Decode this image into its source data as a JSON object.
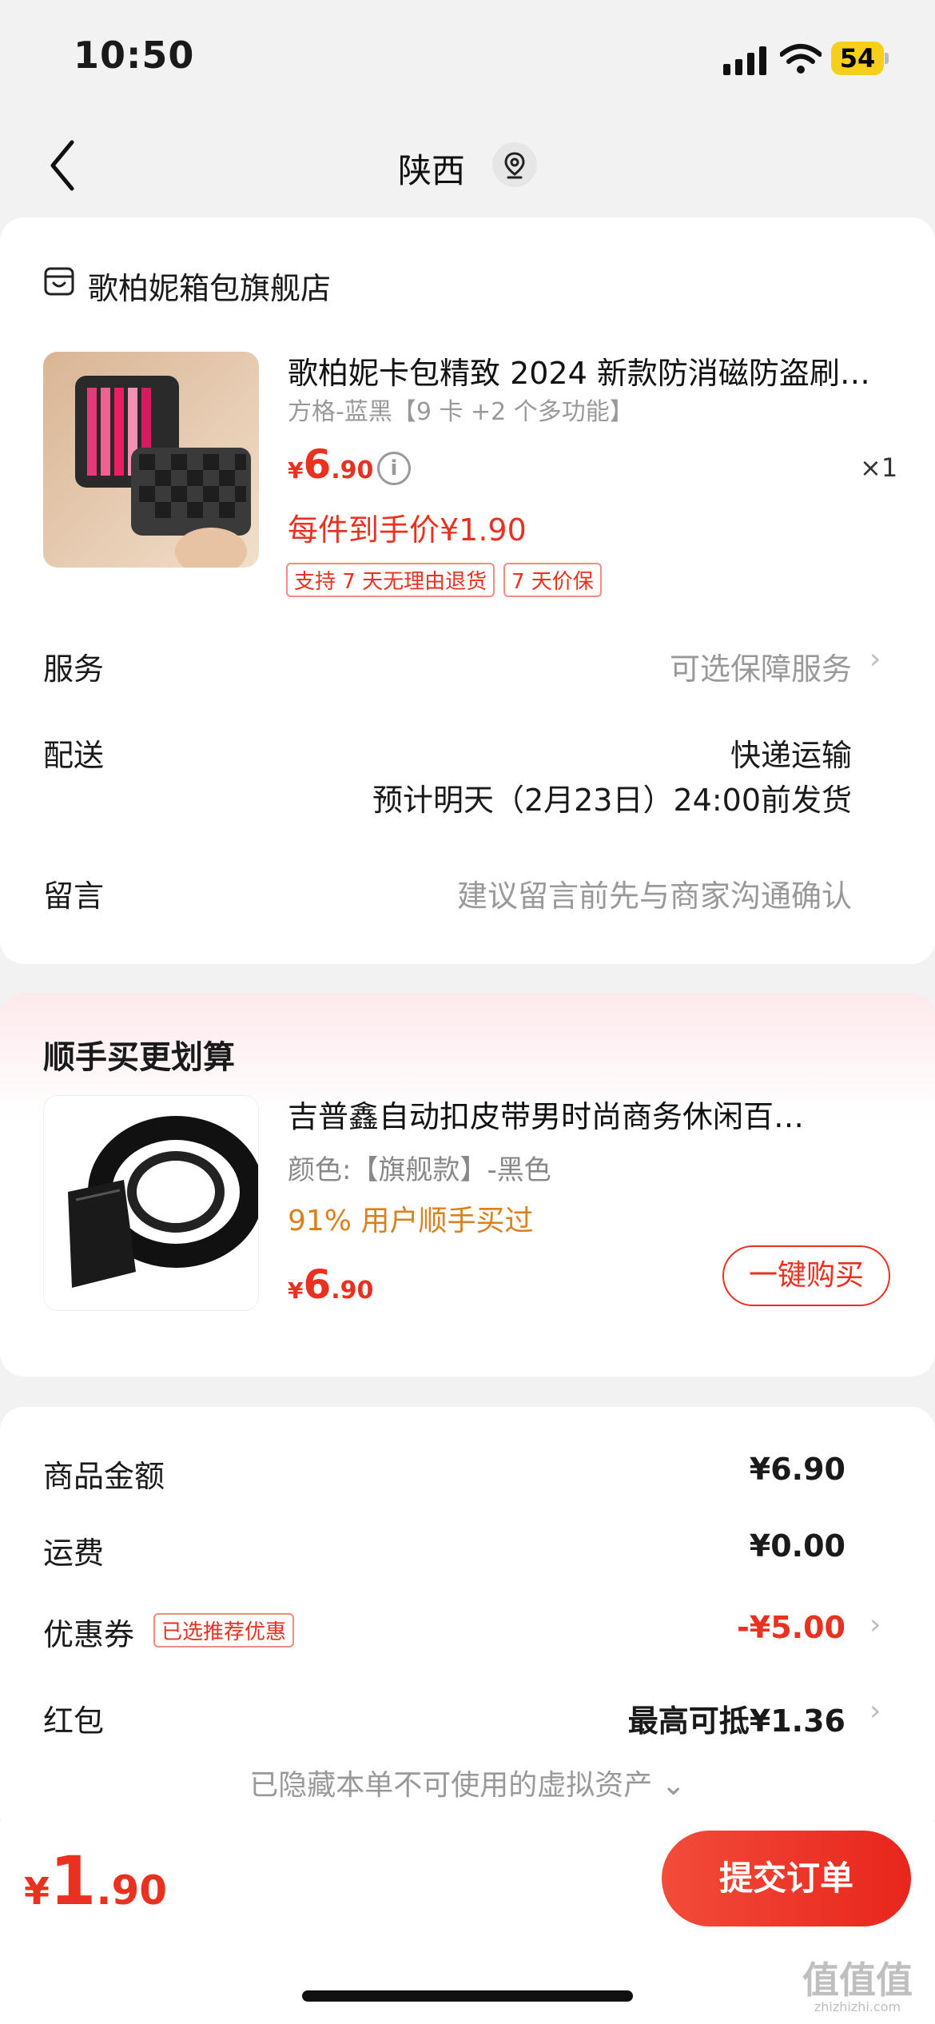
{
  "status_bar": {
    "time": "10:50",
    "battery": "54"
  },
  "header": {
    "title": "陕西",
    "back_icon": "chevron-left-icon",
    "location_icon": "location-pin-icon"
  },
  "shop": {
    "name": "歌柏妮箱包旗舰店"
  },
  "product": {
    "title": "歌柏妮卡包精致 2024 新款防消磁防盗刷…",
    "spec": "方格-蓝黑【9 卡 +2 个多功能】",
    "price": {
      "currency": "¥",
      "int": "6",
      "dec": ".90"
    },
    "quantity": "×1",
    "final_price": "每件到手价¥1.90",
    "tags": [
      "支持 7 天无理由退货",
      "7 天价保"
    ]
  },
  "rows": {
    "service_label": "服务",
    "service_value": "可选保障服务",
    "shipping_label": "配送",
    "shipping_method": "快递运输",
    "shipping_eta": "预计明天（2月23日）24:00前发货",
    "message_label": "留言",
    "message_placeholder": "建议留言前先与商家沟通确认"
  },
  "upsell": {
    "section_title": "顺手买更划算",
    "title": "吉普鑫自动扣皮带男时尚商务休闲百…",
    "spec": "颜色:【旗舰款】-黑色",
    "social": "91% 用户顺手买过",
    "price": {
      "currency": "¥",
      "int": "6",
      "dec": ".90"
    },
    "buy_label": "一键购买"
  },
  "summary": {
    "amount_label": "商品金额",
    "amount_value": "¥6.90",
    "fee_label": "运费",
    "fee_value": "¥0.00",
    "coupon_label": "优惠券",
    "coupon_tag": "已选推荐优惠",
    "coupon_value": "-¥5.00",
    "redpacket_label": "红包",
    "redpacket_value": "最高可抵¥1.36",
    "hidden_note": "已隐藏本单不可使用的虚拟资产 ⌄"
  },
  "footer": {
    "total": {
      "currency": "¥",
      "int": "1",
      "dec": ".90"
    },
    "submit_label": "提交订单"
  },
  "watermark": {
    "big": "值值值",
    "small": "zhizhizhi.com"
  },
  "colors": {
    "accent": "#e8311f",
    "social": "#d9821d",
    "battery": "#f5cf19"
  }
}
